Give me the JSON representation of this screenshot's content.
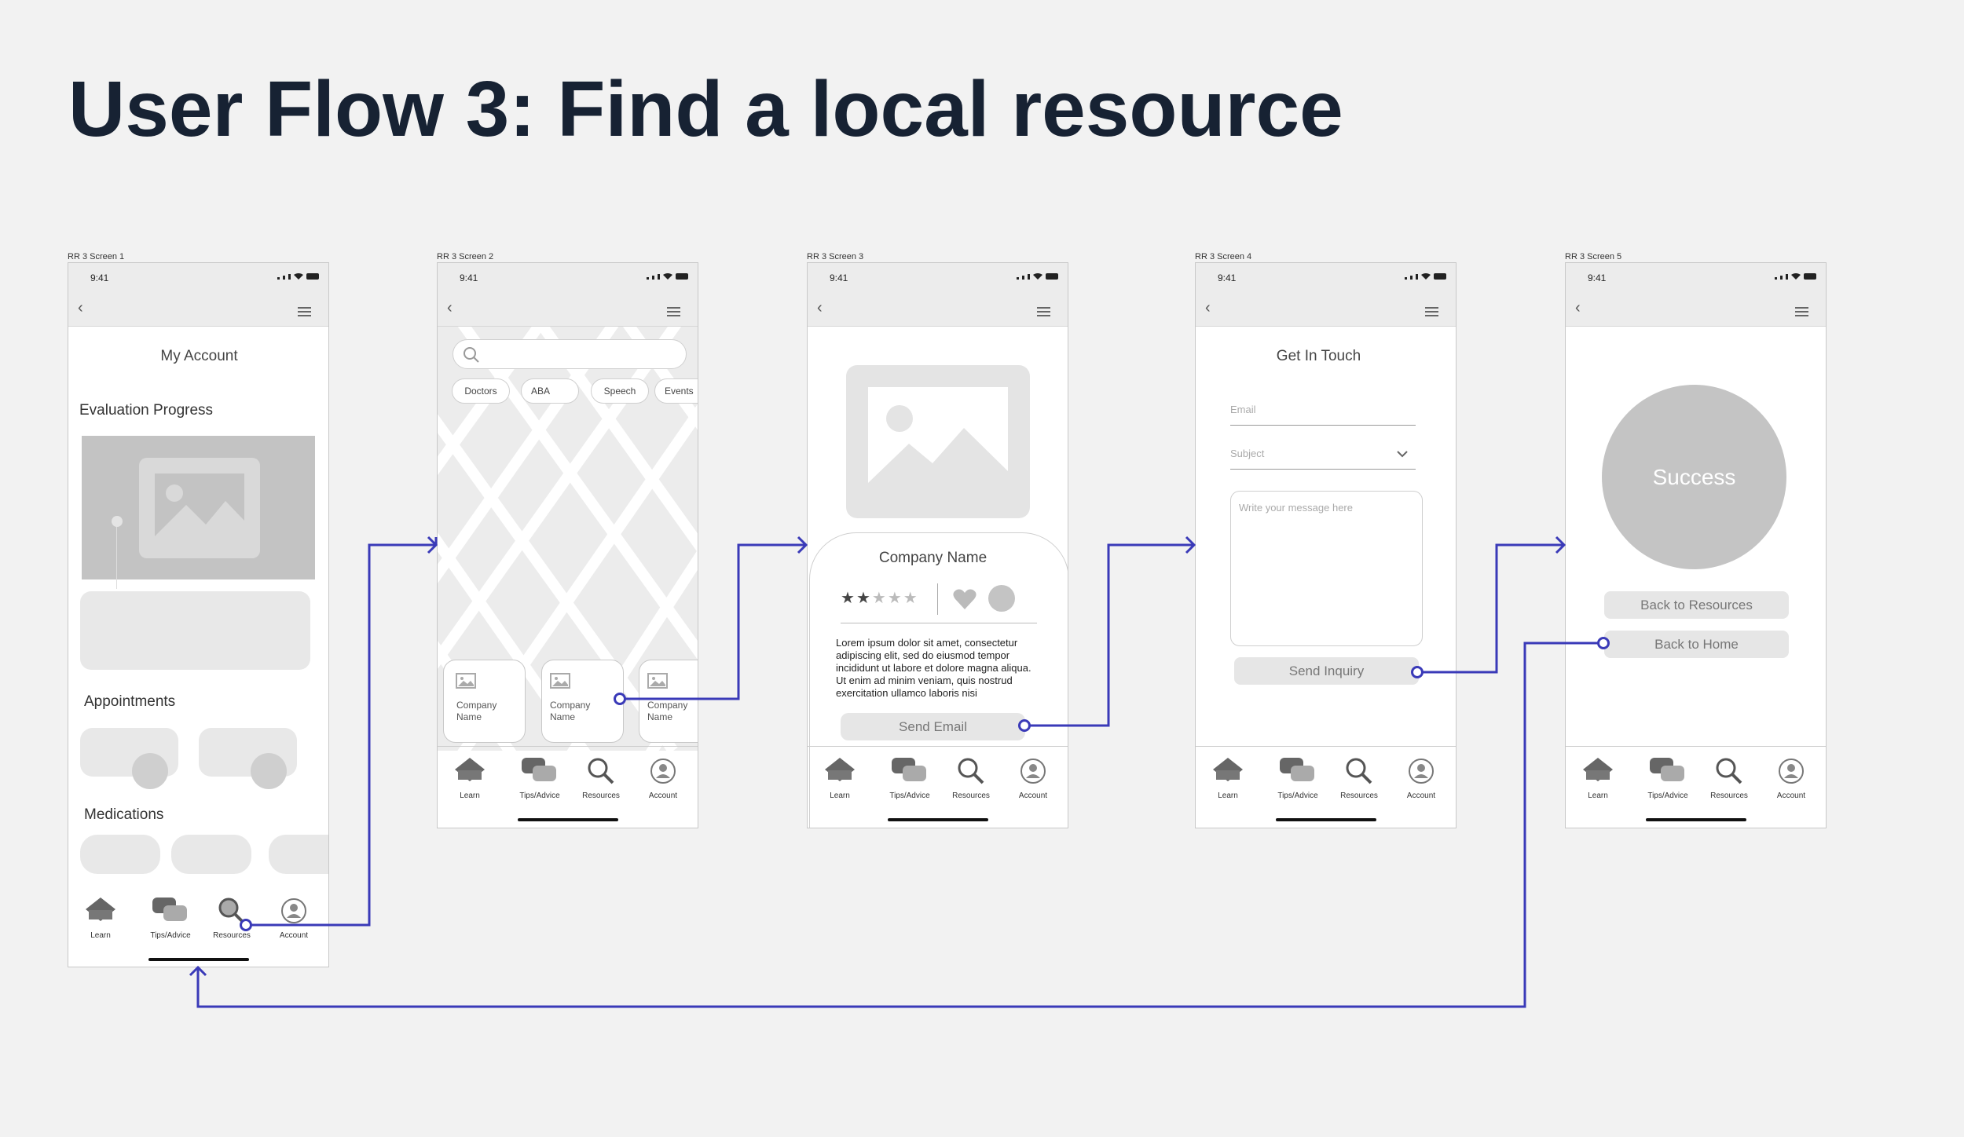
{
  "title": "User Flow 3: Find a local resource",
  "colors": {
    "background": "#f2f2f2",
    "connector": "#3a3ab8",
    "title": "#172233",
    "placeholder": "#bdbdbd"
  },
  "status_time": "9:41",
  "tabs": [
    "Learn",
    "Tips/Advice",
    "Resources",
    "Account"
  ],
  "screens": {
    "s1": {
      "label": "RR 3 Screen 1",
      "heading": "My Account",
      "evaluation_label": "Evaluation Progress",
      "appointments_label": "Appointments",
      "medications_label": "Medications"
    },
    "s2": {
      "label": "RR 3 Screen 2",
      "chips": [
        "Doctors",
        "ABA",
        "Speech",
        "Events"
      ],
      "card1": "Company Name",
      "card2": "Company Name",
      "card3": "Company Name"
    },
    "s3": {
      "label": "RR 3 Screen 3",
      "company": "Company Name",
      "rating_stars": 2,
      "rating_max": 5,
      "body": "Lorem ipsum dolor sit amet, consectetur adipiscing elit, sed do eiusmod tempor incididunt ut labore et dolore magna aliqua. Ut enim ad minim veniam, quis nostrud exercitation ullamco laboris nisi",
      "button": "Send Email"
    },
    "s4": {
      "label": "RR 3 Screen 4",
      "heading": "Get In Touch",
      "email_placeholder": "Email",
      "subject_placeholder": "Subject",
      "message_placeholder": "Write your message here",
      "button": "Send Inquiry"
    },
    "s5": {
      "label": "RR 3 Screen 5",
      "success": "Success",
      "back_resources": "Back to Resources",
      "back_home": "Back to Home"
    }
  },
  "icons": [
    "back-chevron-icon",
    "hamburger-menu-icon",
    "search-icon",
    "image-placeholder-icon",
    "heart-icon",
    "star-icon",
    "chevron-down-icon",
    "learn-icon",
    "chat-bubbles-icon",
    "magnifier-icon",
    "account-icon"
  ]
}
